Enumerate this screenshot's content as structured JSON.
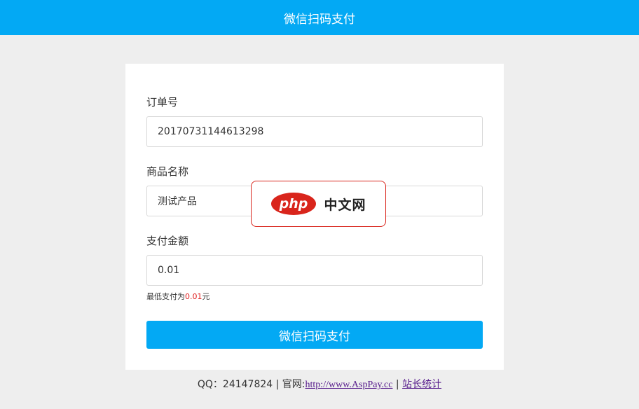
{
  "header": {
    "title": "微信扫码支付"
  },
  "form": {
    "order_label": "订单号",
    "order_value": "20170731144613298",
    "product_label": "商品名称",
    "product_value": "测试产品",
    "amount_label": "支付金额",
    "amount_value": "0.01",
    "hint_prefix": "最低支付为",
    "hint_amount": "0.01",
    "hint_suffix": "元",
    "submit_label": "微信扫码支付"
  },
  "footer": {
    "qq_text": "QQ：24147824 | 官网:",
    "site_link": "http://www.AspPay.cc",
    "separator": " | ",
    "stats_link": "站长统计"
  },
  "watermark": {
    "logo_text": "php",
    "text": "中文网"
  },
  "colors": {
    "accent": "#03a9f4",
    "hint_amount": "#e02020",
    "watermark_red": "#d9251c"
  }
}
